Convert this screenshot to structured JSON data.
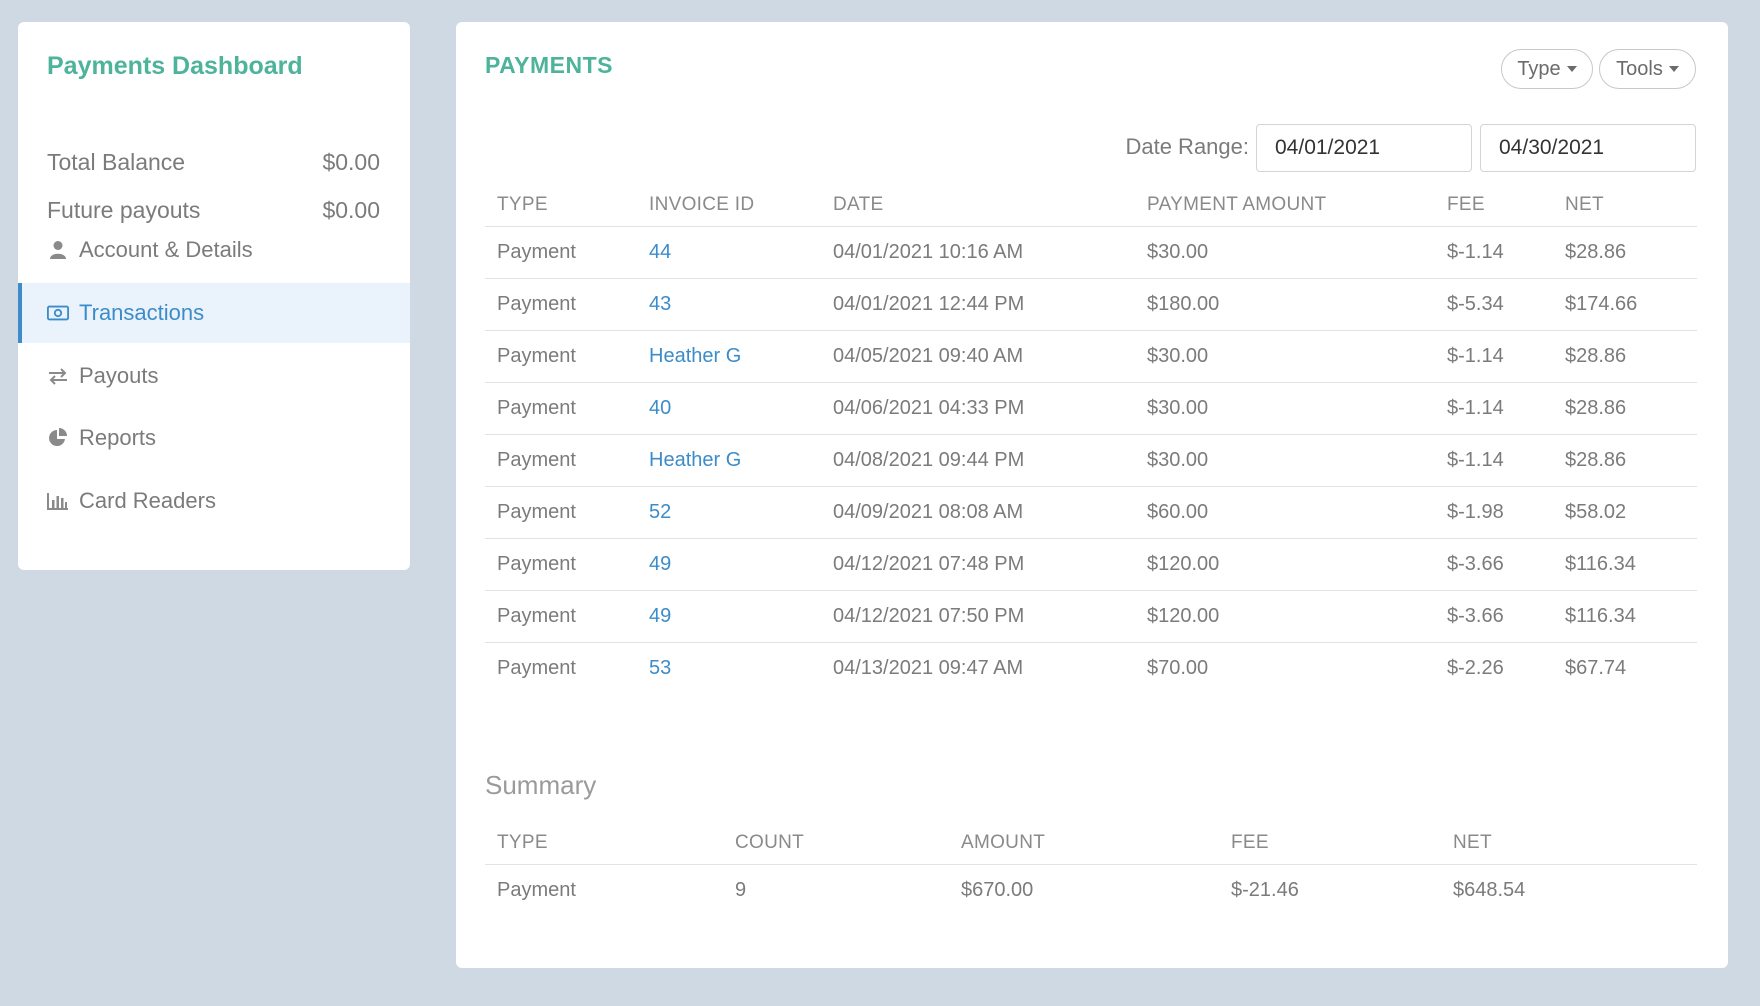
{
  "sidebar": {
    "title": "Payments Dashboard",
    "balances": [
      {
        "label": "Total Balance",
        "value": "$0.00"
      },
      {
        "label": "Future payouts",
        "value": "$0.00"
      }
    ],
    "nav": [
      {
        "label": "Account & Details",
        "icon": "user-icon",
        "active": false
      },
      {
        "label": "Transactions",
        "icon": "money-icon",
        "active": true
      },
      {
        "label": "Payouts",
        "icon": "exchange-arrows-icon",
        "active": false
      },
      {
        "label": "Reports",
        "icon": "pie-chart-icon",
        "active": false
      },
      {
        "label": "Card Readers",
        "icon": "bar-chart-icon",
        "active": false
      }
    ]
  },
  "main": {
    "title": "PAYMENTS",
    "buttons": {
      "type": "Type",
      "tools": "Tools"
    },
    "date_range": {
      "label": "Date Range:",
      "start": "04/01/2021",
      "end": "04/30/2021"
    },
    "columns": [
      "TYPE",
      "INVOICE ID",
      "DATE",
      "PAYMENT AMOUNT",
      "FEE",
      "NET"
    ],
    "rows": [
      {
        "type": "Payment",
        "invoice": "44",
        "date": "04/01/2021 10:16 AM",
        "amount": "$30.00",
        "fee": "$-1.14",
        "net": "$28.86"
      },
      {
        "type": "Payment",
        "invoice": "43",
        "date": "04/01/2021 12:44 PM",
        "amount": "$180.00",
        "fee": "$-5.34",
        "net": "$174.66"
      },
      {
        "type": "Payment",
        "invoice": "Heather G",
        "date": "04/05/2021 09:40 AM",
        "amount": "$30.00",
        "fee": "$-1.14",
        "net": "$28.86"
      },
      {
        "type": "Payment",
        "invoice": "40",
        "date": "04/06/2021 04:33 PM",
        "amount": "$30.00",
        "fee": "$-1.14",
        "net": "$28.86"
      },
      {
        "type": "Payment",
        "invoice": "Heather G",
        "date": "04/08/2021 09:44 PM",
        "amount": "$30.00",
        "fee": "$-1.14",
        "net": "$28.86"
      },
      {
        "type": "Payment",
        "invoice": "52",
        "date": "04/09/2021 08:08 AM",
        "amount": "$60.00",
        "fee": "$-1.98",
        "net": "$58.02"
      },
      {
        "type": "Payment",
        "invoice": "49",
        "date": "04/12/2021 07:48 PM",
        "amount": "$120.00",
        "fee": "$-3.66",
        "net": "$116.34"
      },
      {
        "type": "Payment",
        "invoice": "49",
        "date": "04/12/2021 07:50 PM",
        "amount": "$120.00",
        "fee": "$-3.66",
        "net": "$116.34"
      },
      {
        "type": "Payment",
        "invoice": "53",
        "date": "04/13/2021 09:47 AM",
        "amount": "$70.00",
        "fee": "$-2.26",
        "net": "$67.74"
      }
    ],
    "summary": {
      "title": "Summary",
      "columns": [
        "TYPE",
        "COUNT",
        "AMOUNT",
        "FEE",
        "NET"
      ],
      "rows": [
        {
          "type": "Payment",
          "count": "9",
          "amount": "$670.00",
          "fee": "$-21.46",
          "net": "$648.54"
        }
      ]
    }
  },
  "colors": {
    "accent_green": "#4db39a",
    "link_blue": "#3c8cc9",
    "background": "#cfd9e3"
  }
}
